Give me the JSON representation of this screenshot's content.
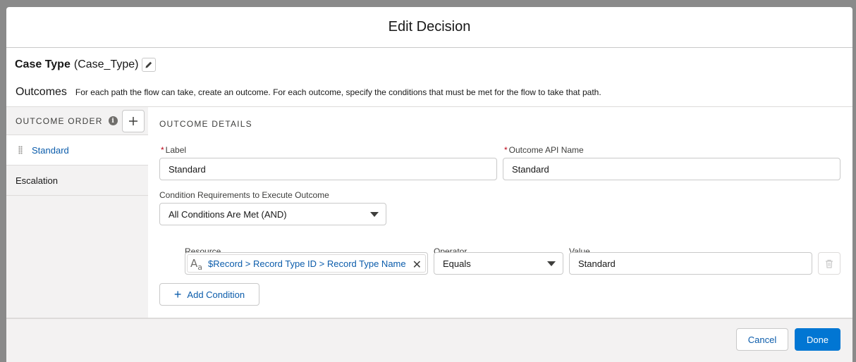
{
  "modal": {
    "title": "Edit Decision"
  },
  "element": {
    "label": "Case Type",
    "api_name": "(Case_Type)",
    "edit_icon": "pencil-icon"
  },
  "outcomes_section": {
    "title": "Outcomes",
    "description": "For each path the flow can take, create an outcome. For each outcome, specify the conditions that must be met for the flow to take that path."
  },
  "sidebar": {
    "header": "OUTCOME ORDER",
    "info_icon": "info-icon",
    "add_icon": "plus-icon",
    "items": [
      {
        "label": "Standard",
        "selected": true
      },
      {
        "label": "Escalation",
        "selected": false
      }
    ]
  },
  "details": {
    "title": "OUTCOME DETAILS",
    "label_field": {
      "label": "Label",
      "value": "Standard",
      "required": "*"
    },
    "api_field": {
      "label": "Outcome API Name",
      "value": "Standard",
      "required": "*"
    },
    "condition_req": {
      "label": "Condition Requirements to Execute Outcome",
      "value": "All Conditions Are Met (AND)"
    },
    "condition": {
      "resource_label": "Resource",
      "resource_value": "$Record > Record Type ID > Record Type Name",
      "resource_type_icon": "text-type-icon",
      "operator_label": "Operator",
      "operator_value": "Equals",
      "value_label": "Value",
      "value_value": "Standard",
      "delete_icon": "trash-icon"
    },
    "add_condition_label": "Add Condition"
  },
  "footer": {
    "cancel_label": "Cancel",
    "done_label": "Done"
  },
  "colors": {
    "brand": "#0176d3",
    "link": "#0b5cab",
    "required": "#ba0517",
    "backdrop": "#8a8a8a"
  }
}
